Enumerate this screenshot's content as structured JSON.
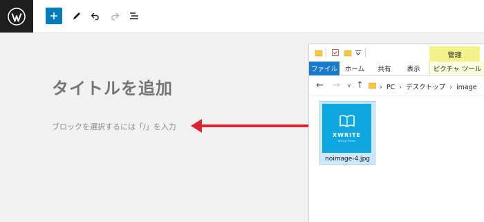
{
  "wp_toolbar": {
    "logo_icon": "wordpress-logo-icon",
    "add_icon": "plus-icon",
    "tools": [
      "edit-pencil-icon",
      "undo-icon",
      "redo-icon",
      "list-view-icon"
    ],
    "accent": "#007cba"
  },
  "editor": {
    "title_placeholder": "タイトルを追加",
    "block_hint": "ブロックを選択するには「/」を入力",
    "arrow_color": "#e0242f"
  },
  "explorer": {
    "contextual_tab": "管理",
    "ribbon_tabs": [
      "ファイル",
      "ホーム",
      "共有",
      "表示",
      "ピクチャ ツール"
    ],
    "path": [
      "PC",
      "デスクトップ",
      "image"
    ],
    "file": {
      "name": "noimage-4.jpg",
      "thumb_title": "XWRITE",
      "thumb_sub": "Writing Theme"
    }
  }
}
